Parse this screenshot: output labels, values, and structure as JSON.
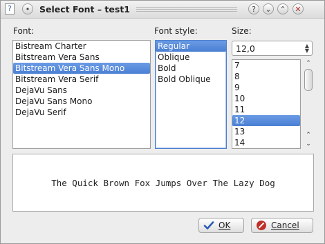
{
  "window": {
    "title": "Select Font – test1",
    "help_glyph": "?",
    "menu_glyph": "•",
    "controls": {
      "help": "?",
      "minimize": "⌄",
      "maximize": "⌃"
    }
  },
  "font": {
    "label": "Font:",
    "items": [
      "Bistream Charter",
      "Bitstream Vera Sans",
      "Bitstream Vera Sans Mono",
      "Bitstream Vera Serif",
      "DejaVu Sans",
      "DejaVu Sans Mono",
      "DejaVu Serif"
    ],
    "selected_index": 2
  },
  "style": {
    "label": "Font style:",
    "items": [
      "Regular",
      "Oblique",
      "Bold",
      "Bold Oblique"
    ],
    "selected_index": 0
  },
  "size": {
    "label": "Size:",
    "value": "12,0",
    "items": [
      "7",
      "8",
      "9",
      "10",
      "11",
      "12",
      "13",
      "14"
    ],
    "selected_index": 5
  },
  "preview": {
    "text": "The Quick Brown Fox Jumps Over The Lazy Dog"
  },
  "buttons": {
    "ok": "OK",
    "cancel": "Cancel"
  },
  "colors": {
    "selection": "#4a7fd4",
    "focus_border": "#4d7fd0",
    "cancel_icon": "#c0302a",
    "ok_icon": "#2a5cb8"
  }
}
